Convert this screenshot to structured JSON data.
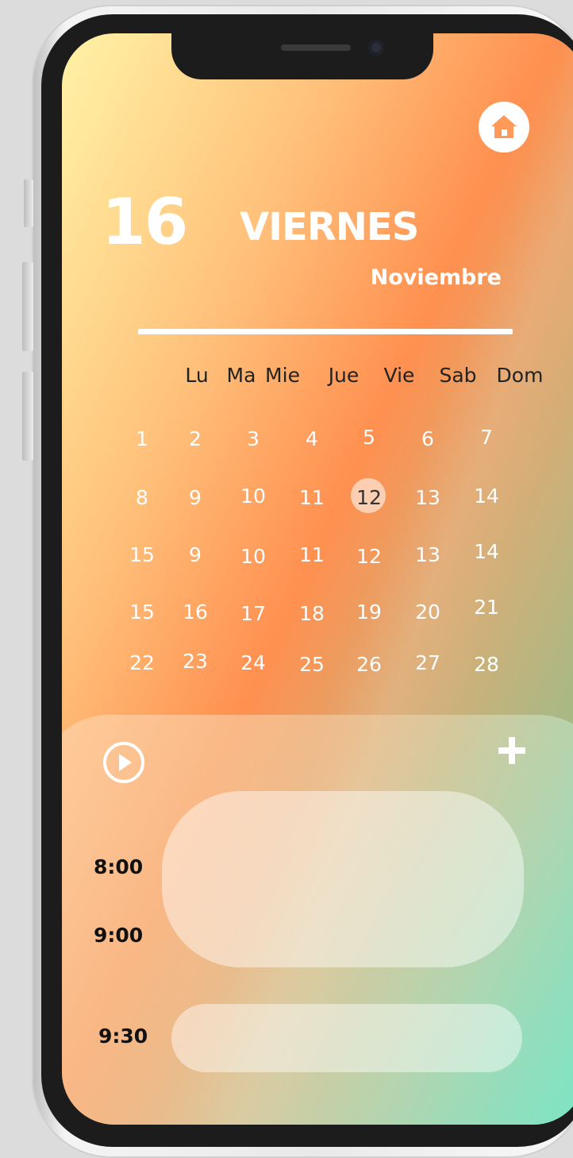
{
  "header": {
    "day_number": "16",
    "weekday": "VIERNES",
    "month": "Noviembre",
    "home_icon": "home-icon"
  },
  "calendar": {
    "weekdays": [
      "Lu",
      "Ma",
      "Mie",
      "Jue",
      "Vie",
      "Sab",
      "Dom"
    ],
    "weeks": [
      [
        "1",
        "2",
        "3",
        "4",
        "5",
        "6",
        "7"
      ],
      [
        "8",
        "9",
        "10",
        "11",
        "12",
        "13",
        "14"
      ],
      [
        "15",
        "9",
        "10",
        "11",
        "12",
        "13",
        "14"
      ],
      [
        "15",
        "16",
        "17",
        "18",
        "19",
        "20",
        "21"
      ],
      [
        "22",
        "23",
        "24",
        "25",
        "26",
        "27",
        "28"
      ]
    ],
    "selected_day": "12"
  },
  "schedule": {
    "times": [
      "8:00",
      "9:00",
      "9:30"
    ],
    "play_icon": "play-circle-icon",
    "add_icon": "plus-icon"
  },
  "colors": {
    "gradient_start": "#fff3a6",
    "gradient_mid": "#ff9050",
    "gradient_end": "#69c99a",
    "text_dark": "#222222",
    "text_light": "#ffffff"
  }
}
